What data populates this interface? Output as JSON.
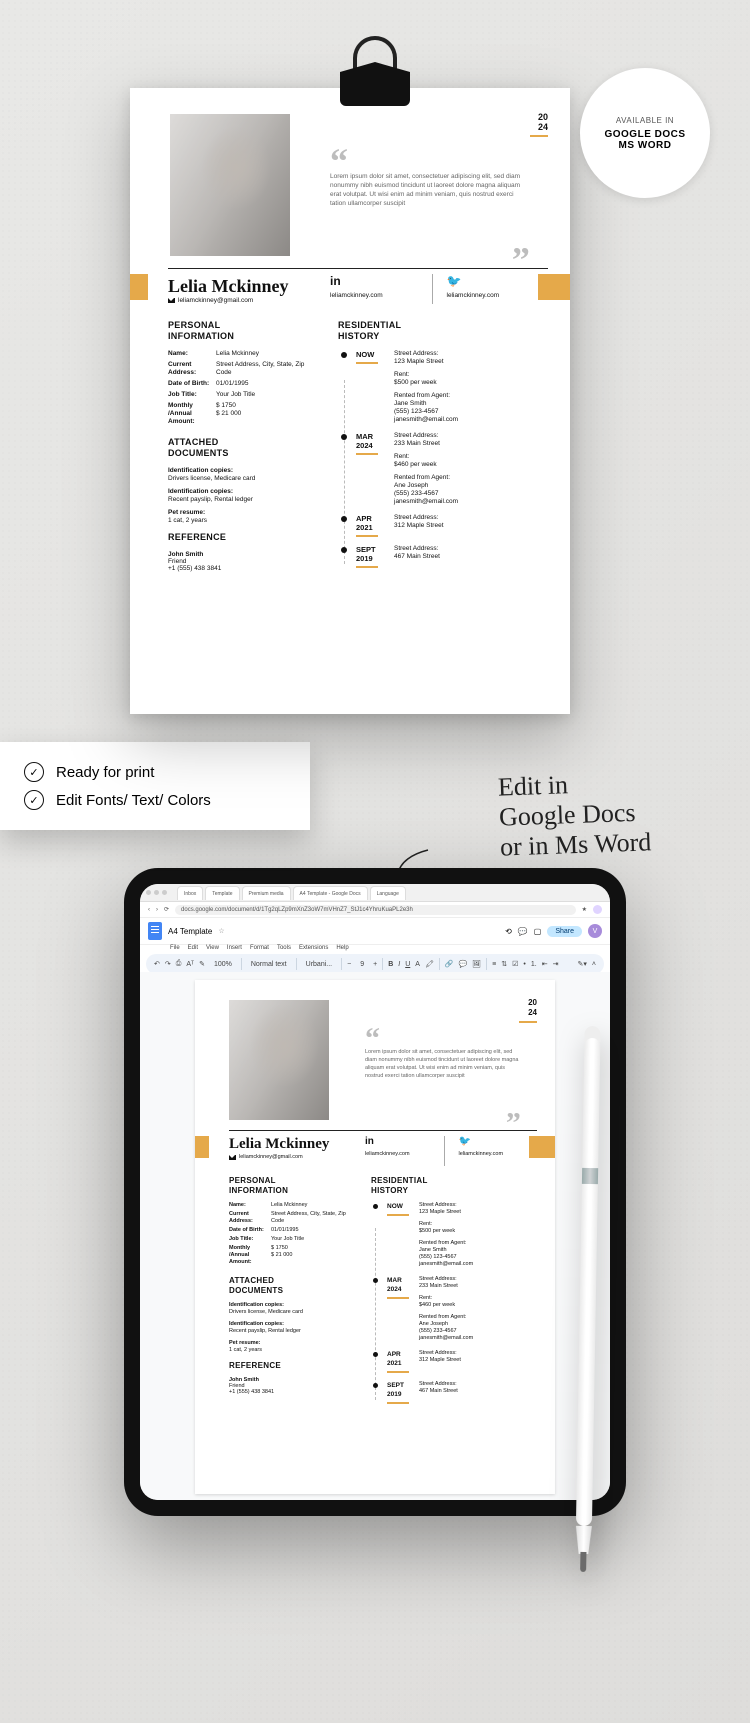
{
  "badge": {
    "line1": "AVAILABLE IN",
    "line2": "GOOGLE DOCS",
    "line3": "MS WORD"
  },
  "checklist": {
    "item1": "Ready for print",
    "item2": "Edit Fonts/ Text/ Colors"
  },
  "hand_note": {
    "l1": "Edit in",
    "l2": "Google Docs",
    "l3": "or in Ms Word"
  },
  "resume": {
    "year": {
      "a": "20",
      "b": "24"
    },
    "bio": "Lorem ipsum dolor sit amet, consectetuer adipiscing elit, sed diam nonummy nibh euismod tincidunt ut laoreet dolore magna aliquam erat volutpat. Ut wisi enim ad minim veniam, quis nostrud exerci tation ullamcorper suscipit",
    "name": "Lelia Mckinney",
    "email": "leliamckinney@gmail.com",
    "linkedin": "leliamckinney.com",
    "twitter": "leliamckinney.com",
    "personal": {
      "title": "PERSONAL INFORMATION",
      "rows": [
        {
          "k": "Name:",
          "v": "Lelia Mckinney"
        },
        {
          "k": "Current Address:",
          "v": "Street Address, City, State, Zip Code"
        },
        {
          "k": "Date of Birth:",
          "v": "01/01/1995"
        },
        {
          "k": "Job Title:",
          "v": "Your Job Title"
        },
        {
          "k": "Monthly /Annual Amount:",
          "v": "$ 1750\n$ 21 000"
        }
      ]
    },
    "attached": {
      "title": "ATTACHED DOCUMENTS",
      "items": [
        {
          "k": "Identification copies:",
          "v": "Drivers license, Medicare card"
        },
        {
          "k": "Identification copies:",
          "v": "Recent payslip, Rental ledger"
        },
        {
          "k": "Pet resume:",
          "v": "1 cat, 2 years"
        }
      ]
    },
    "reference": {
      "title": "REFERENCE",
      "name": "John Smith",
      "rel": "Friend",
      "tel": "+1 (555) 438 3841"
    },
    "residential": {
      "title": "RESIDENTIAL HISTORY",
      "entries": [
        {
          "date": "NOW",
          "lines": [
            "Street Address:",
            "123 Maple Street",
            "",
            "Rent:",
            "$500 per week",
            "",
            "Rented from Agent:",
            "Jane Smith",
            "(555) 123-4567",
            "janesmith@email.com"
          ]
        },
        {
          "date": "MAR 2024",
          "lines": [
            "Street Address:",
            "233 Main Street",
            "",
            "Rent:",
            "$460 per week",
            "",
            "Rented from Agent:",
            "Ane Joseph",
            "(555) 233-4567",
            "janesmith@email.com"
          ]
        },
        {
          "date": "APR 2021",
          "lines": [
            "Street Address:",
            "312 Maple Street"
          ]
        },
        {
          "date": "SEPT 2019",
          "lines": [
            "Street Address:",
            "467 Main Street"
          ]
        }
      ]
    }
  },
  "docs": {
    "tabs": [
      "Inbox",
      "Template",
      "Premium media",
      "A4 Template - Google Docs",
      "Language"
    ],
    "url": "docs.google.com/document/d/1Tg2qLZp9mXnZ3oW7mVHnZ7_StJ1c4YhruKuaPL2e3h",
    "title": "A4 Template",
    "menu": [
      "File",
      "Edit",
      "View",
      "Insert",
      "Format",
      "Tools",
      "Extensions",
      "Help"
    ],
    "share": "Share",
    "toolbar": {
      "zoom": "100%",
      "style": "Normal text",
      "font": "Urbani...",
      "size": "9"
    },
    "avatar": "V"
  }
}
